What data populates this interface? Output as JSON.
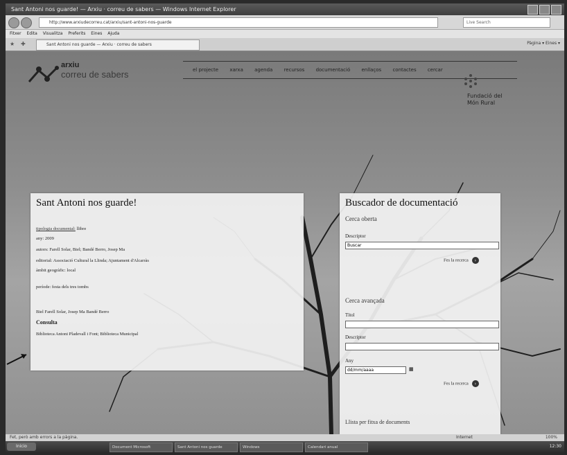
{
  "window": {
    "title": "Sant Antoni nos guarde! — Arxiu · correu de sabers — Windows Internet Explorer",
    "address": "http://www.arxiudecorreu.cat/arxiu/sant-antoni-nos-guarde",
    "search_placeholder": "Live Search",
    "menu": [
      "Fitxer",
      "Edita",
      "Visualitza",
      "Preferits",
      "Eines",
      "Ajuda"
    ],
    "tab_label": "Sant Antoni nos guarde — Arxiu · correu de sabers",
    "toolbar_right": "Pàgina ▾  Eines ▾"
  },
  "site": {
    "logo_top": "arxiu",
    "logo_bottom": "correu de sabers",
    "nav": [
      "el projecte",
      "xarxa",
      "agenda",
      "recursos",
      "documentació",
      "enllaços",
      "contactes",
      "cercar"
    ],
    "foundation_line1": "Fundació del",
    "foundation_line2": "Món Rural"
  },
  "record": {
    "title": "Sant Antoni nos guarde!",
    "type_label": "tipologia documental:",
    "type_value": "llibre",
    "year": "any: 2009",
    "authors": "autors: Farell Solar, Biel; Bandé Berro, Josep Ma",
    "publisher": "editorial: Associació Cultural la Llinda; Ajuntament d'Alcarràs",
    "scope": "àmbit geogràfic: local",
    "period_label": "període:",
    "period_value": "festa dels tres tombs",
    "keywords": "Biel Farell Solar, Josep Ma Bandé Berro",
    "consult_heading": "Consulta",
    "libraries": "Biblioteca Antoni Pladevall i Font; Biblioteca Municipal"
  },
  "search_panel": {
    "title": "Buscador de documentació",
    "open_search": "Cerca oberta",
    "desc_label": "Descriptor",
    "desc_value": "Buscar",
    "do_search": "Fes la recerca",
    "advanced": "Cerca avançada",
    "title_label": "Títol",
    "author_label": "Descriptor",
    "year_label": "Any",
    "year_value": "dd/mm/aaaa",
    "do_search2": "Fes la recerca",
    "list_link": "Llista per fitxa de documents"
  },
  "status": {
    "left": "Fet, però amb errors a la pàgina.",
    "zone": "Internet",
    "zoom": "100%"
  },
  "taskbar": {
    "start": "Inicio",
    "items": [
      "Document Microsoft",
      "Sant Antoni nos guarde",
      "Windows",
      "Calendari anual"
    ],
    "clock": "12:30"
  },
  "colors": {
    "panel": "#f2f2f2",
    "accent": "#222222"
  }
}
